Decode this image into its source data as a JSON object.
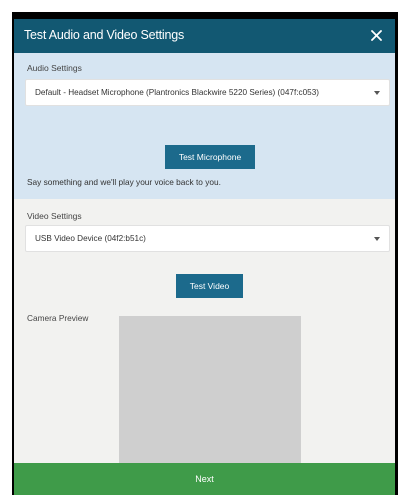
{
  "dialog": {
    "title": "Test Audio and Video Settings",
    "close_icon": "close-icon"
  },
  "audio": {
    "section_label": "Audio Settings",
    "selected_device": "Default - Headset Microphone (Plantronics Blackwire 5220 Series) (047f:c053)",
    "test_button_label": "Test Microphone",
    "hint": "Say something and we'll play your voice back to you."
  },
  "video": {
    "section_label": "Video Settings",
    "selected_device": "USB Video Device (04f2:b51c)",
    "test_button_label": "Test Video",
    "preview_label": "Camera Preview"
  },
  "footer": {
    "next_label": "Next"
  },
  "colors": {
    "title_bar": "#125872",
    "audio_section_bg": "#d6e5f2",
    "button": "#1c6a8c",
    "next_bar": "#3f9b49"
  }
}
